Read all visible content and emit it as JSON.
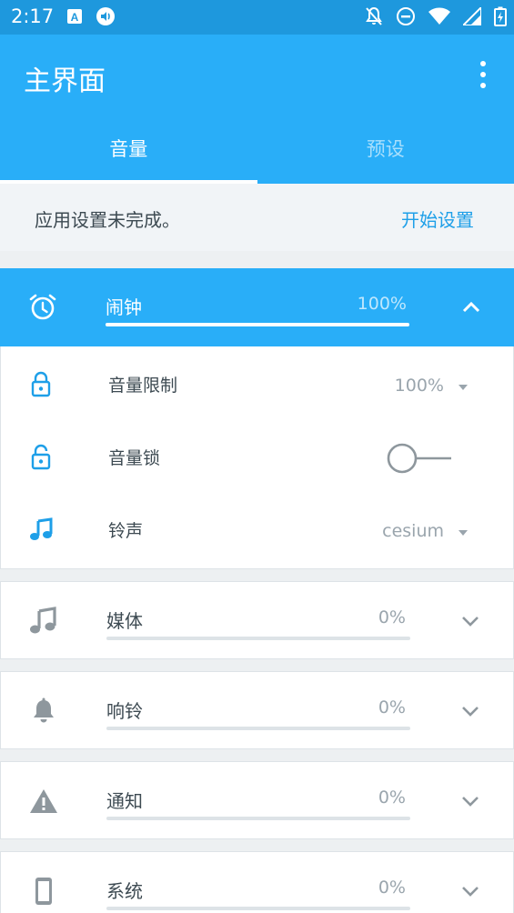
{
  "status_bar": {
    "time": "2:17",
    "left_icons": [
      "keyboard-a-icon",
      "volume-circle-icon"
    ],
    "right_icons": [
      "bell-off-icon",
      "do-not-disturb-icon",
      "wifi-icon",
      "signal-icon",
      "battery-charging-icon"
    ]
  },
  "app_bar": {
    "title": "主界面",
    "menu_icon": "more-vert-icon"
  },
  "tabs": [
    {
      "label": "音量",
      "active": true
    },
    {
      "label": "预设",
      "active": false
    }
  ],
  "notice": {
    "message": "应用设置未完成。",
    "action": "开始设置"
  },
  "expanded_stream": {
    "icon": "alarm-clock-icon",
    "label": "闹钟",
    "value": "100%",
    "level": 1.0,
    "settings": [
      {
        "icon": "lock-icon",
        "label": "音量限制",
        "value": "100%"
      },
      {
        "icon": "lock-open-icon",
        "label": "音量锁",
        "toggle_on": false
      },
      {
        "icon": "music-note-icon",
        "label": "铃声",
        "value": "cesium"
      }
    ]
  },
  "streams": [
    {
      "icon": "music-note-icon",
      "label": "媒体",
      "value": "0%",
      "level": 0
    },
    {
      "icon": "bell-icon",
      "label": "响铃",
      "value": "0%",
      "level": 0
    },
    {
      "icon": "warning-icon",
      "label": "通知",
      "value": "0%",
      "level": 0
    },
    {
      "icon": "phone-icon",
      "label": "系统",
      "value": "0%",
      "level": 0
    }
  ],
  "colors": {
    "primary": "#29aef8",
    "status_bar": "#1e98dd",
    "accent_text": "#1e9fe8",
    "icon_gray": "#8e979d"
  }
}
